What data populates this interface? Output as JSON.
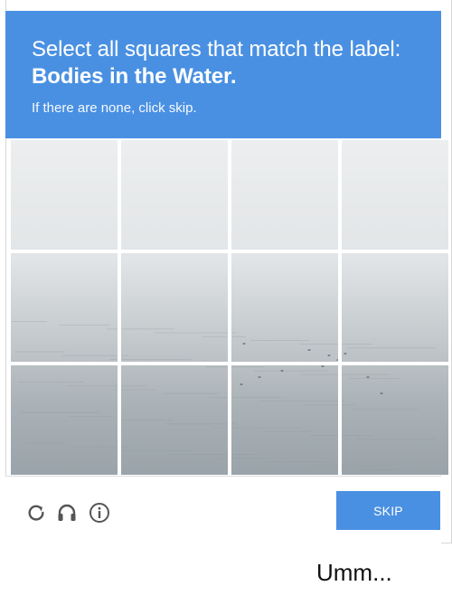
{
  "header": {
    "prompt_prefix": "Select all squares that match the label: ",
    "label": "Bodies in the Water.",
    "hint": "If there are none, click skip."
  },
  "grid": {
    "rows": 3,
    "columns": 4,
    "image_description_name": "foggy-sea-image"
  },
  "controls": {
    "reload_icon": "reload-icon",
    "audio_icon": "headphones-icon",
    "info_icon": "info-icon",
    "skip_label": "SKIP"
  },
  "caption": {
    "text": "Umm..."
  },
  "colors": {
    "accent": "#4a90e2",
    "icon": "#555555"
  }
}
